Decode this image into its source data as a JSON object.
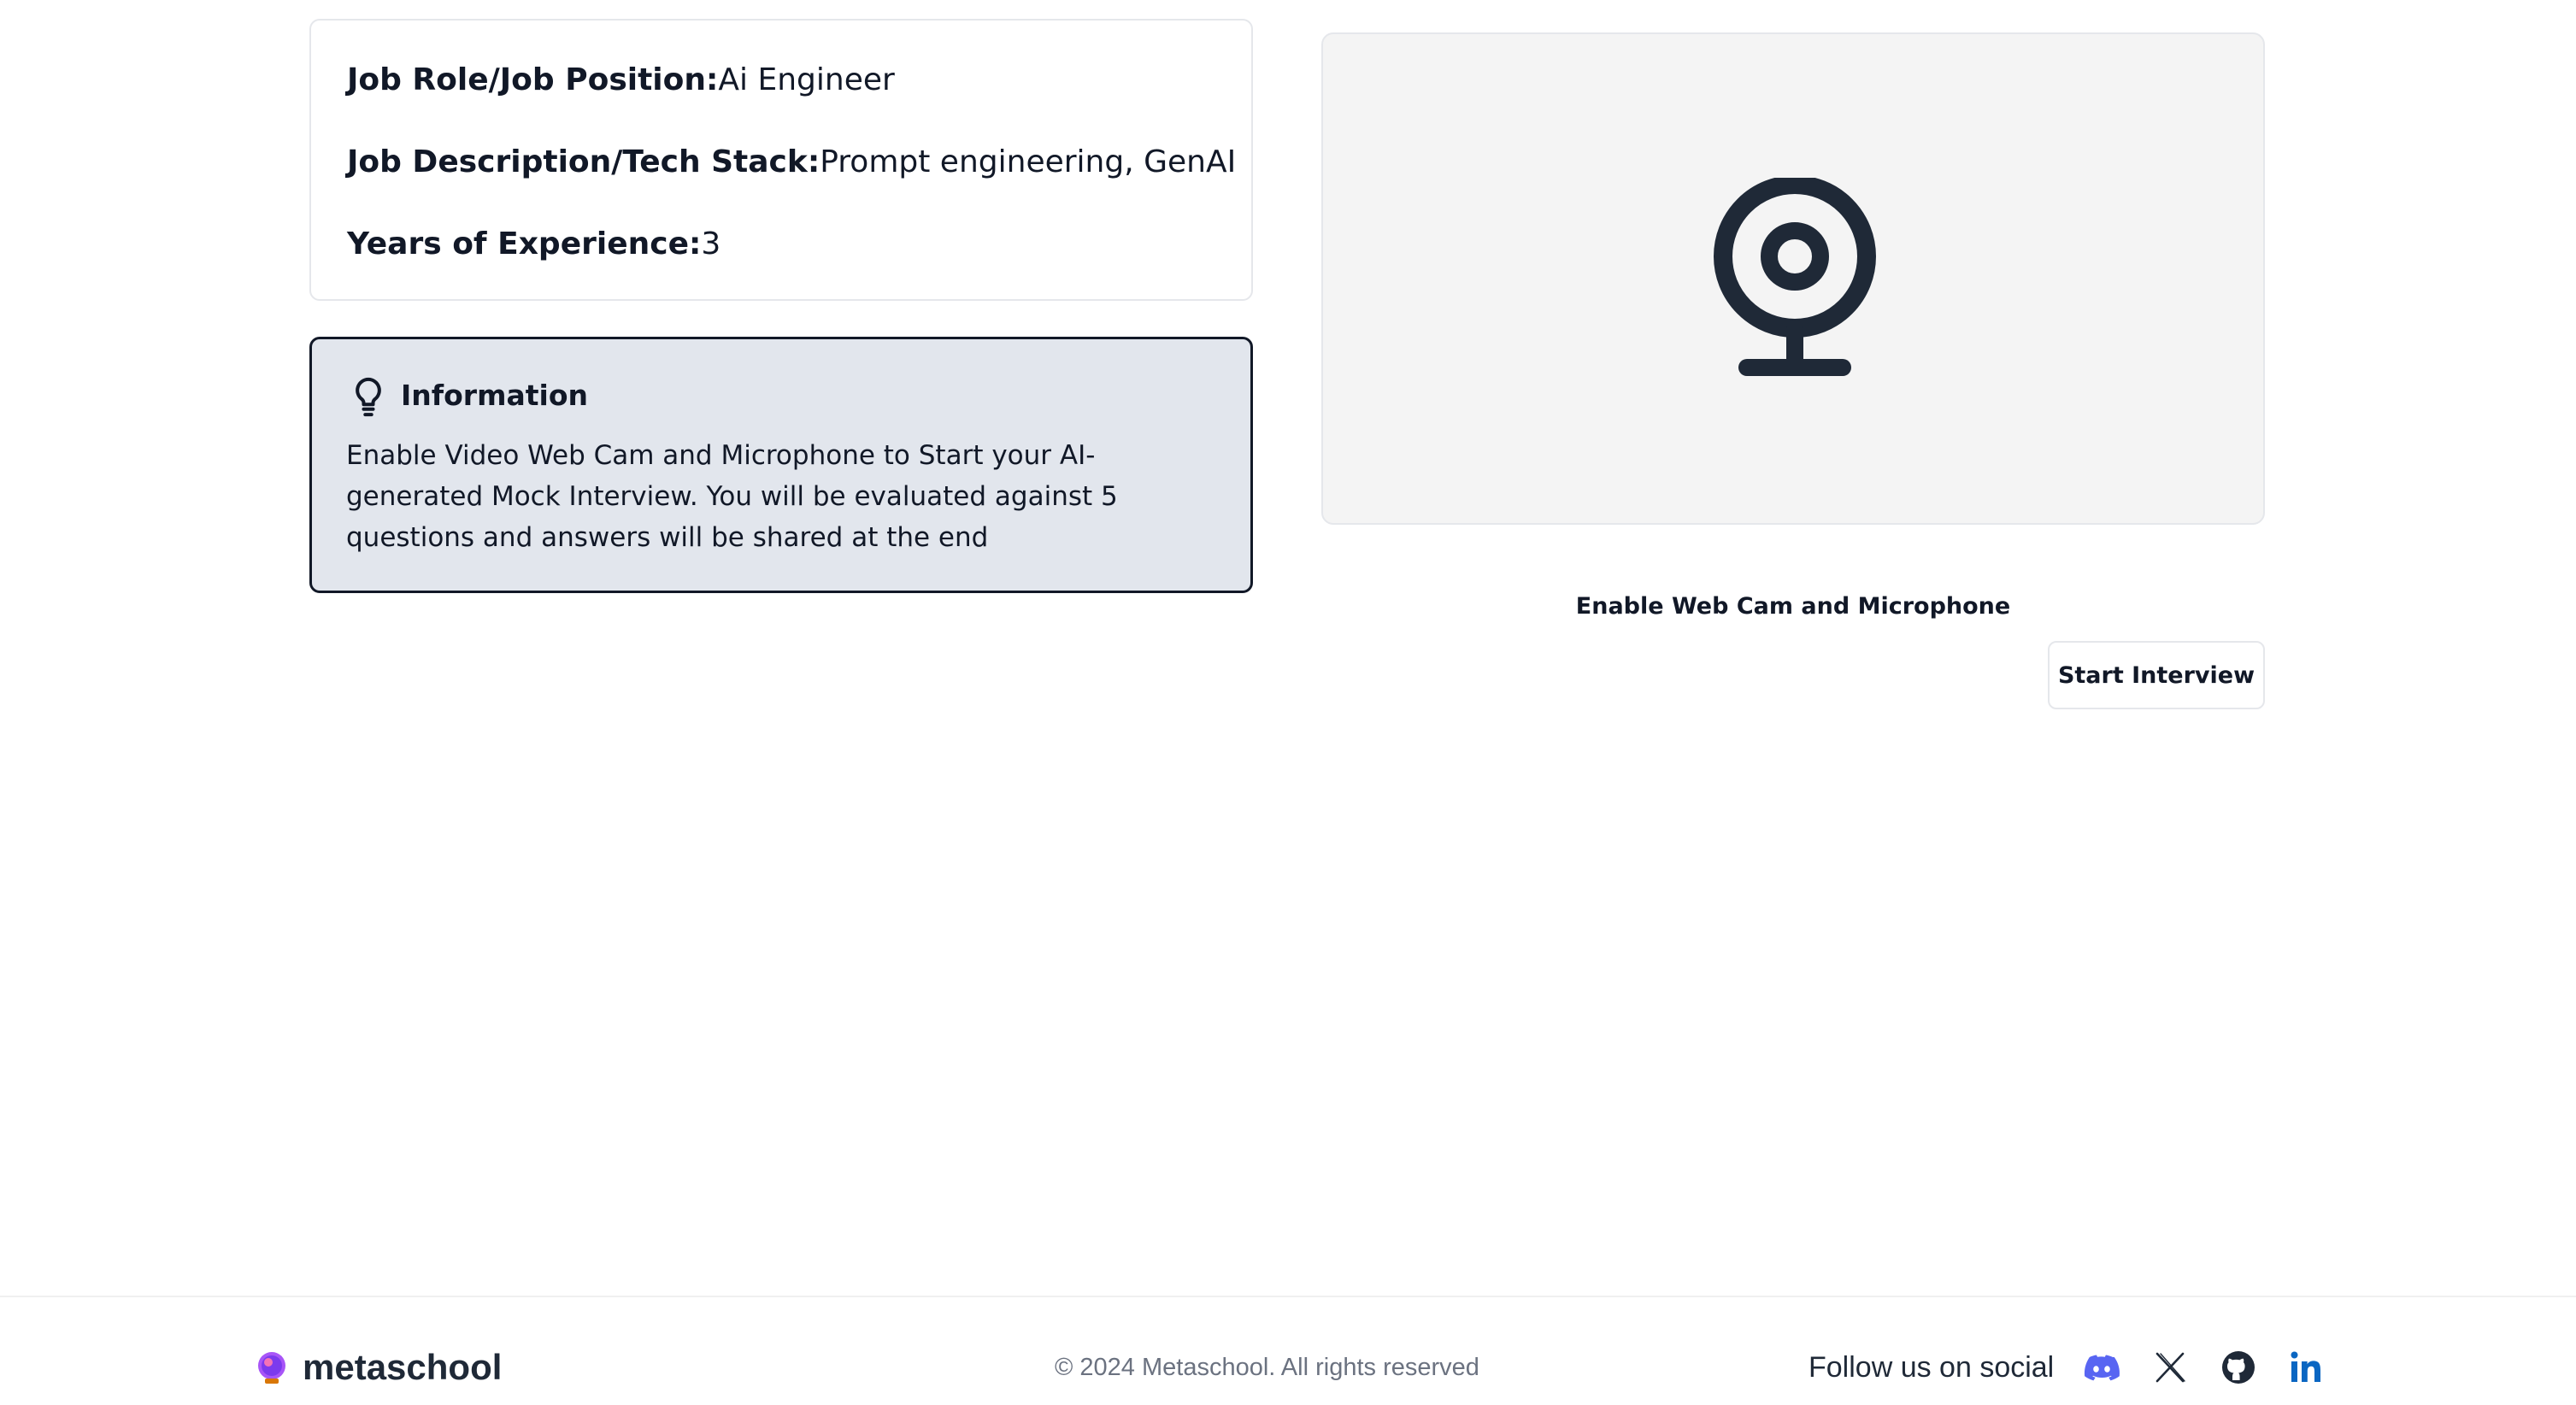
{
  "job": {
    "role_label": "Job Role/Job Position:",
    "role_value": "Ai Engineer",
    "desc_label": "Job Description/Tech Stack:",
    "desc_value": "Prompt engineering, GenAI",
    "exp_label": "Years of Experience:",
    "exp_value": "3"
  },
  "info": {
    "icon": "lightbulb-icon",
    "title": "Information",
    "text": "Enable Video Web Cam and Microphone to Start your AI-generated Mock Interview. You will be evaluated against 5 questions and answers will be shared at the end"
  },
  "webcam": {
    "icon": "webcam-icon",
    "enable_label": "Enable Web Cam and Microphone",
    "start_button": "Start Interview"
  },
  "footer": {
    "brand": "metaschool",
    "copyright": "© 2024 Metaschool. All rights reserved",
    "social_label": "Follow us on social",
    "social_icons": [
      "discord-icon",
      "x-icon",
      "github-icon",
      "linkedin-icon"
    ]
  },
  "colors": {
    "info_background": "#e2e6ed",
    "webcam_panel": "#f4f4f4",
    "discord": "#5865f2",
    "linkedin": "#0a66c2",
    "text": "#111827"
  }
}
